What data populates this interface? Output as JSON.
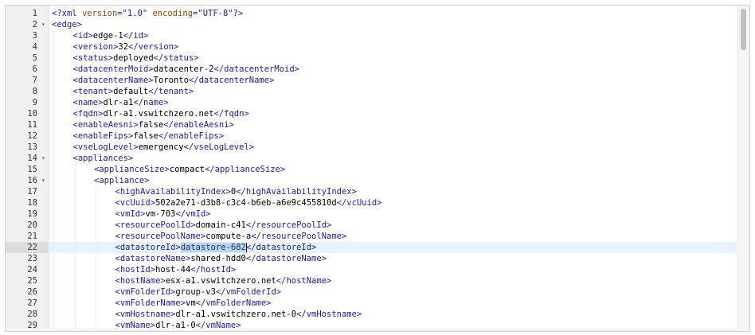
{
  "editor": {
    "active_line": 22,
    "scroll_fraction": 0.0,
    "lines": [
      {
        "n": "1",
        "fold": false,
        "depth": 0,
        "parts": [
          [
            "pi",
            "<?xml "
          ],
          [
            "attr",
            "version"
          ],
          [
            "pi",
            "="
          ],
          [
            "str",
            "\"1.0\""
          ],
          [
            "pi",
            " "
          ],
          [
            "attr",
            "encoding"
          ],
          [
            "pi",
            "="
          ],
          [
            "str",
            "\"UTF-8\""
          ],
          [
            "pi",
            "?>"
          ]
        ]
      },
      {
        "n": "2",
        "fold": true,
        "depth": 0,
        "parts": [
          [
            "tag",
            "<edge>"
          ]
        ]
      },
      {
        "n": "3",
        "fold": false,
        "depth": 1,
        "parts": [
          [
            "tag",
            "<id>"
          ],
          [
            "txt",
            "edge-1"
          ],
          [
            "tag",
            "</id>"
          ]
        ]
      },
      {
        "n": "4",
        "fold": false,
        "depth": 1,
        "parts": [
          [
            "tag",
            "<version>"
          ],
          [
            "txt",
            "32"
          ],
          [
            "tag",
            "</version>"
          ]
        ]
      },
      {
        "n": "5",
        "fold": false,
        "depth": 1,
        "parts": [
          [
            "tag",
            "<status>"
          ],
          [
            "txt",
            "deployed"
          ],
          [
            "tag",
            "</status>"
          ]
        ]
      },
      {
        "n": "6",
        "fold": false,
        "depth": 1,
        "parts": [
          [
            "tag",
            "<datacenterMoid>"
          ],
          [
            "txt",
            "datacenter-2"
          ],
          [
            "tag",
            "</datacenterMoid>"
          ]
        ]
      },
      {
        "n": "7",
        "fold": false,
        "depth": 1,
        "parts": [
          [
            "tag",
            "<datacenterName>"
          ],
          [
            "txt",
            "Toronto"
          ],
          [
            "tag",
            "</datacenterName>"
          ]
        ]
      },
      {
        "n": "8",
        "fold": false,
        "depth": 1,
        "parts": [
          [
            "tag",
            "<tenant>"
          ],
          [
            "txt",
            "default"
          ],
          [
            "tag",
            "</tenant>"
          ]
        ]
      },
      {
        "n": "9",
        "fold": false,
        "depth": 1,
        "parts": [
          [
            "tag",
            "<name>"
          ],
          [
            "txt",
            "dlr-a1"
          ],
          [
            "tag",
            "</name>"
          ]
        ]
      },
      {
        "n": "10",
        "fold": false,
        "depth": 1,
        "parts": [
          [
            "tag",
            "<fqdn>"
          ],
          [
            "txt",
            "dlr-a1.vswitchzero.net"
          ],
          [
            "tag",
            "</fqdn>"
          ]
        ]
      },
      {
        "n": "11",
        "fold": false,
        "depth": 1,
        "parts": [
          [
            "tag",
            "<enableAesni>"
          ],
          [
            "txt",
            "false"
          ],
          [
            "tag",
            "</enableAesni>"
          ]
        ]
      },
      {
        "n": "12",
        "fold": false,
        "depth": 1,
        "parts": [
          [
            "tag",
            "<enableFips>"
          ],
          [
            "txt",
            "false"
          ],
          [
            "tag",
            "</enableFips>"
          ]
        ]
      },
      {
        "n": "13",
        "fold": false,
        "depth": 1,
        "parts": [
          [
            "tag",
            "<vseLogLevel>"
          ],
          [
            "txt",
            "emergency"
          ],
          [
            "tag",
            "</vseLogLevel>"
          ]
        ]
      },
      {
        "n": "14",
        "fold": true,
        "depth": 1,
        "parts": [
          [
            "tag",
            "<appliances>"
          ]
        ]
      },
      {
        "n": "15",
        "fold": false,
        "depth": 2,
        "parts": [
          [
            "tag",
            "<applianceSize>"
          ],
          [
            "txt",
            "compact"
          ],
          [
            "tag",
            "</applianceSize>"
          ]
        ]
      },
      {
        "n": "16",
        "fold": true,
        "depth": 2,
        "parts": [
          [
            "tag",
            "<appliance>"
          ]
        ]
      },
      {
        "n": "17",
        "fold": false,
        "depth": 3,
        "parts": [
          [
            "tag",
            "<highAvailabilityIndex>"
          ],
          [
            "txt",
            "0"
          ],
          [
            "tag",
            "</highAvailabilityIndex>"
          ]
        ]
      },
      {
        "n": "18",
        "fold": false,
        "depth": 3,
        "parts": [
          [
            "tag",
            "<vcUuid>"
          ],
          [
            "txt",
            "502a2e71-d3b8-c3c4-b6eb-a6e9c455810d"
          ],
          [
            "tag",
            "</vcUuid>"
          ]
        ]
      },
      {
        "n": "19",
        "fold": false,
        "depth": 3,
        "parts": [
          [
            "tag",
            "<vmId>"
          ],
          [
            "txt",
            "vm-703"
          ],
          [
            "tag",
            "</vmId>"
          ]
        ]
      },
      {
        "n": "20",
        "fold": false,
        "depth": 3,
        "parts": [
          [
            "tag",
            "<resourcePoolId>"
          ],
          [
            "txt",
            "domain-c41"
          ],
          [
            "tag",
            "</resourcePoolId>"
          ]
        ]
      },
      {
        "n": "21",
        "fold": false,
        "depth": 3,
        "parts": [
          [
            "tag",
            "<resourcePoolName>"
          ],
          [
            "txt",
            "compute-a"
          ],
          [
            "tag",
            "</resourcePoolName>"
          ]
        ]
      },
      {
        "n": "22",
        "fold": false,
        "depth": 3,
        "parts": [
          [
            "tag",
            "<datastoreId>"
          ],
          [
            "sel",
            "datastore-682"
          ],
          [
            "cursor",
            ""
          ],
          [
            "tag",
            "</datastoreId>"
          ]
        ]
      },
      {
        "n": "23",
        "fold": false,
        "depth": 3,
        "parts": [
          [
            "tag",
            "<datastoreName>"
          ],
          [
            "txt",
            "shared-hdd0"
          ],
          [
            "tag",
            "</datastoreName>"
          ]
        ]
      },
      {
        "n": "24",
        "fold": false,
        "depth": 3,
        "parts": [
          [
            "tag",
            "<hostId>"
          ],
          [
            "txt",
            "host-44"
          ],
          [
            "tag",
            "</hostId>"
          ]
        ]
      },
      {
        "n": "25",
        "fold": false,
        "depth": 3,
        "parts": [
          [
            "tag",
            "<hostName>"
          ],
          [
            "txt",
            "esx-a1.vswitchzero.net"
          ],
          [
            "tag",
            "</hostName>"
          ]
        ]
      },
      {
        "n": "26",
        "fold": false,
        "depth": 3,
        "parts": [
          [
            "tag",
            "<vmFolderId>"
          ],
          [
            "txt",
            "group-v3"
          ],
          [
            "tag",
            "</vmFolderId>"
          ]
        ]
      },
      {
        "n": "27",
        "fold": false,
        "depth": 3,
        "parts": [
          [
            "tag",
            "<vmFolderName>"
          ],
          [
            "txt",
            "vm"
          ],
          [
            "tag",
            "</vmFolderName>"
          ]
        ]
      },
      {
        "n": "28",
        "fold": false,
        "depth": 3,
        "parts": [
          [
            "tag",
            "<vmHostname>"
          ],
          [
            "txt",
            "dlr-a1.vswitchzero.net-0"
          ],
          [
            "tag",
            "</vmHostname>"
          ]
        ]
      },
      {
        "n": "29",
        "fold": false,
        "depth": 3,
        "parts": [
          [
            "tag",
            "<vmName>"
          ],
          [
            "txt",
            "dlr-a1-0"
          ],
          [
            "tag",
            "</vmName>"
          ]
        ]
      }
    ]
  }
}
